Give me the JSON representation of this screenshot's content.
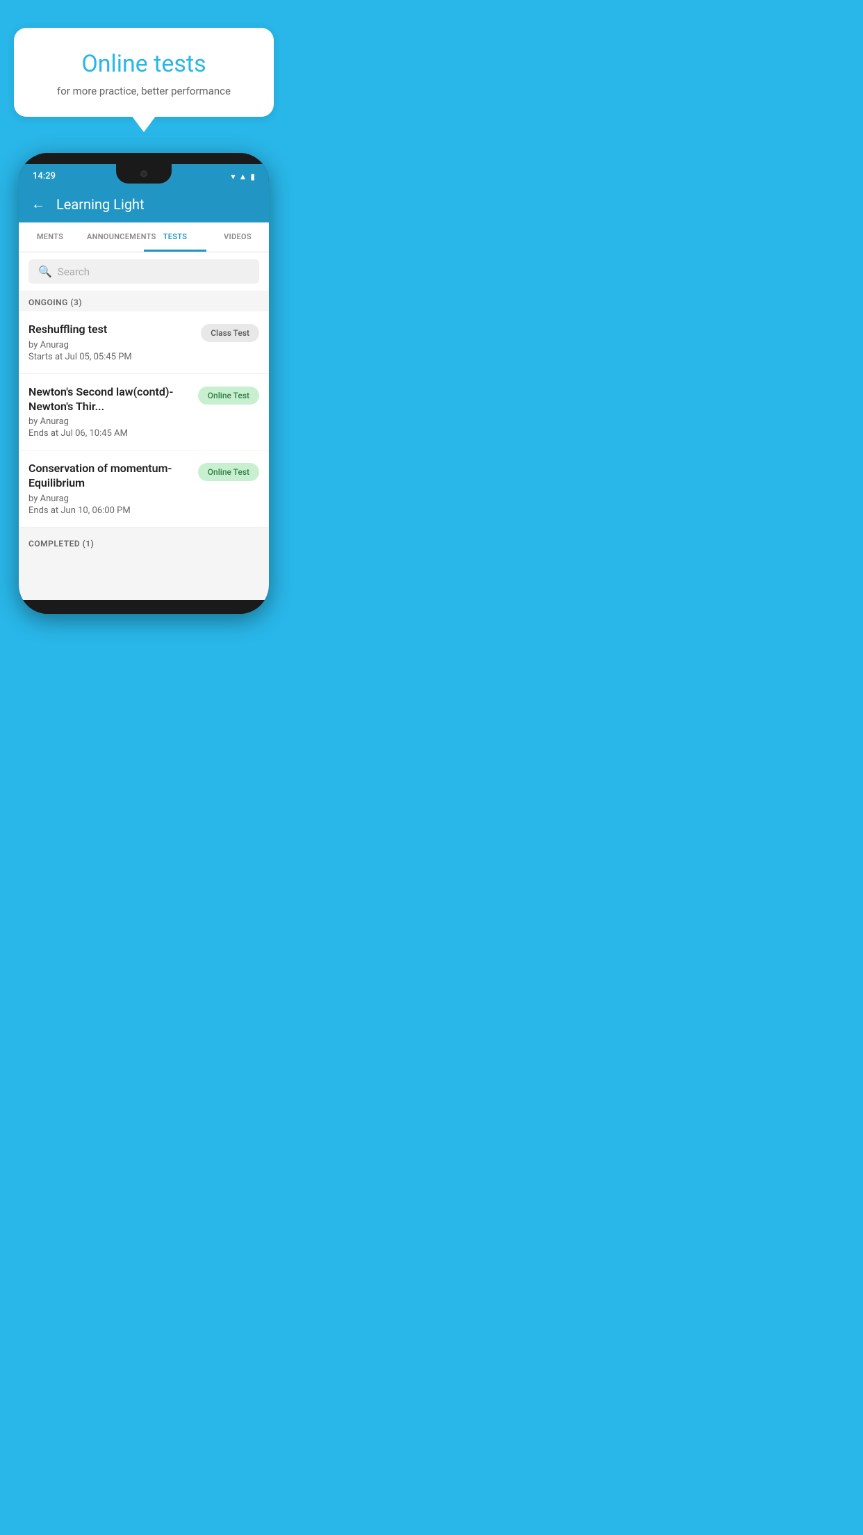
{
  "background": {
    "color": "#29b6e8"
  },
  "bubble": {
    "title": "Online tests",
    "subtitle": "for more practice, better performance"
  },
  "phone": {
    "statusBar": {
      "time": "14:29",
      "icons": [
        "wifi",
        "signal",
        "battery"
      ]
    },
    "appBar": {
      "backLabel": "←",
      "title": "Learning Light"
    },
    "tabs": [
      {
        "label": "MENTS",
        "active": false
      },
      {
        "label": "ANNOUNCEMENTS",
        "active": false
      },
      {
        "label": "TESTS",
        "active": true
      },
      {
        "label": "VIDEOS",
        "active": false
      }
    ],
    "search": {
      "placeholder": "Search"
    },
    "sections": [
      {
        "header": "ONGOING (3)",
        "items": [
          {
            "title": "Reshuffling test",
            "by": "by Anurag",
            "time": "Starts at  Jul 05, 05:45 PM",
            "badge": "Class Test",
            "badgeType": "class"
          },
          {
            "title": "Newton's Second law(contd)-Newton's Thir...",
            "by": "by Anurag",
            "time": "Ends at  Jul 06, 10:45 AM",
            "badge": "Online Test",
            "badgeType": "online"
          },
          {
            "title": "Conservation of momentum-Equilibrium",
            "by": "by Anurag",
            "time": "Ends at  Jun 10, 06:00 PM",
            "badge": "Online Test",
            "badgeType": "online"
          }
        ]
      }
    ],
    "completedHeader": "COMPLETED (1)"
  }
}
